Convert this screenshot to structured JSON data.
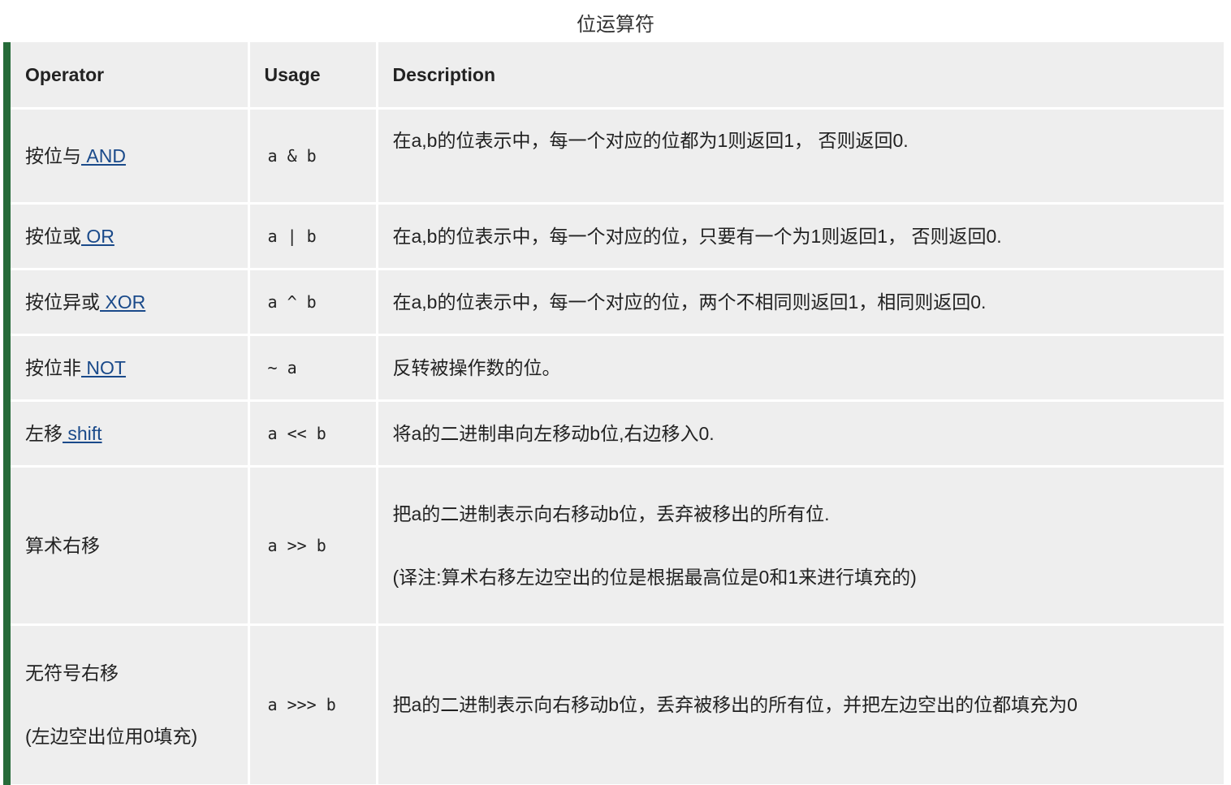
{
  "caption": "位运算符",
  "headers": {
    "operator": "Operator",
    "usage": "Usage",
    "description": "Description"
  },
  "rows": [
    {
      "name": "按位与",
      "link": " AND",
      "usage": "a & b",
      "description": "在a,b的位表示中，每一个对应的位都为1则返回1， 否则返回0."
    },
    {
      "name": "按位或",
      "link": " OR",
      "usage": "a | b",
      "description": "在a,b的位表示中，每一个对应的位，只要有一个为1则返回1， 否则返回0."
    },
    {
      "name": "按位异或",
      "link": " XOR",
      "usage": "a ^ b",
      "description": "在a,b的位表示中，每一个对应的位，两个不相同则返回1，相同则返回0."
    },
    {
      "name": "按位非",
      "link": " NOT",
      "usage": "~ a",
      "description": "反转被操作数的位。"
    },
    {
      "name": "左移",
      "link": " shift",
      "usage": "a << b",
      "description": "将a的二进制串向左移动b位,右边移入0."
    },
    {
      "name": "算术右移",
      "usage": "a >> b",
      "description": "把a的二进制表示向右移动b位，丢弃被移出的所有位.",
      "note": "(译注:算术右移左边空出的位是根据最高位是0和1来进行填充的)"
    },
    {
      "name": "无符号右移",
      "name_note": "(左边空出位用0填充)",
      "usage": "a >>> b",
      "description": "把a的二进制表示向右移动b位，丢弃被移出的所有位，并把左边空出的位都填充为0"
    }
  ],
  "colors": {
    "accent_bar": "#266b39",
    "cell_bg": "#eeeeee",
    "link": "#1a4a8a"
  }
}
